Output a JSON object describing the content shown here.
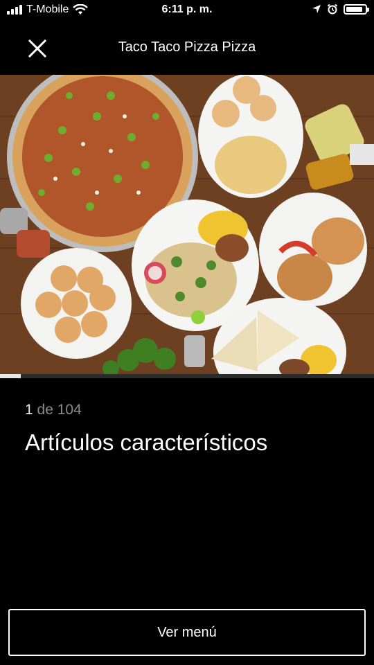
{
  "status_bar": {
    "carrier": "T-Mobile",
    "time": "6:11 p. m.",
    "battery_level": 0.9
  },
  "header": {
    "title": "Taco Taco Pizza Pizza",
    "close_icon": "close-icon"
  },
  "gallery": {
    "current": "1",
    "separator": " de ",
    "total": "104",
    "progress": 0.01,
    "section_title": "Artículos característicos"
  },
  "footer": {
    "button_label": "Ver menú"
  },
  "colors": {
    "background": "#000000",
    "text": "#ffffff",
    "muted_text": "#8b8b8b"
  }
}
